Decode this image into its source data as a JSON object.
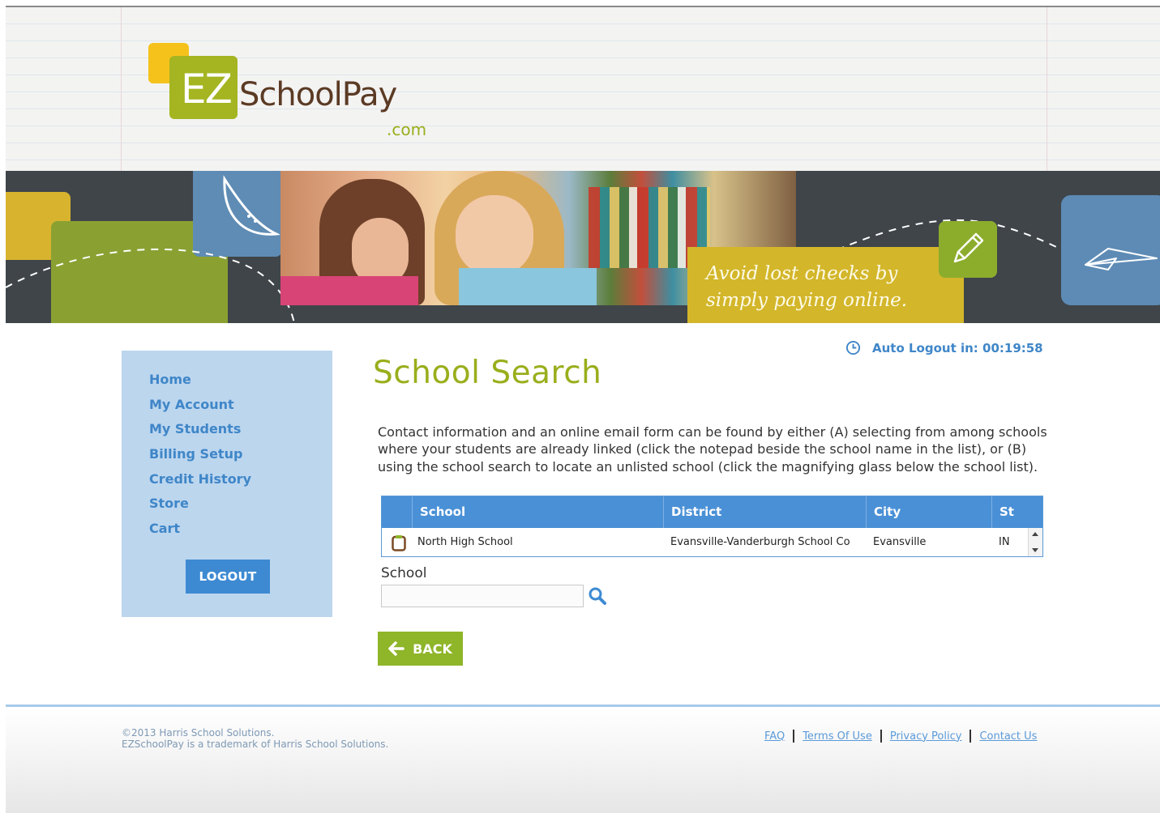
{
  "header": {
    "logo_ez": "EZ",
    "logo_brand": "SchoolPay",
    "logo_dotcom": ".com"
  },
  "banner": {
    "promo_line1": "Avoid lost checks by",
    "promo_line2": "simply paying online."
  },
  "sidebar": {
    "items": [
      {
        "label": "Home"
      },
      {
        "label": "My Account"
      },
      {
        "label": "My Students"
      },
      {
        "label": "Billing Setup"
      },
      {
        "label": "Credit History"
      },
      {
        "label": "Store"
      },
      {
        "label": "Cart"
      }
    ],
    "logout_label": "LOGOUT"
  },
  "main": {
    "auto_logout": "Auto Logout in: 00:19:58",
    "title": "School Search",
    "intro": "Contact information and an online email form can be found by either (A) selecting from among schools where your students are already linked (click the notepad beside the school name in the list), or (B) using the school search to locate an unlisted school (click the magnifying glass below the school list).",
    "table": {
      "headers": [
        "School",
        "District",
        "City",
        "St"
      ],
      "rows": [
        [
          "North High School",
          "Evansville-Vanderburgh School Co",
          "Evansville",
          "IN"
        ]
      ]
    },
    "school_label": "School",
    "school_value": "",
    "back_label": "BACK"
  },
  "footer": {
    "copyright_line1": "©2013 Harris School Solutions.",
    "copyright_line2": "EZSchoolPay is a trademark of Harris School Solutions.",
    "links": [
      "FAQ",
      "Terms Of Use",
      "Privacy Policy",
      "Contact Us"
    ]
  },
  "colors": {
    "accent_green": "#9aae1c",
    "link_blue": "#3f86c8",
    "sidebar_bg": "#bcd6ee",
    "grid_header": "#4a90d6",
    "back_button": "#8fb529",
    "logout_button": "#3d8ad2"
  },
  "icons": [
    "clock-icon",
    "notepad-icon",
    "search-icon",
    "arrow-left-icon",
    "pencil-icon",
    "paper-plane-icon"
  ]
}
